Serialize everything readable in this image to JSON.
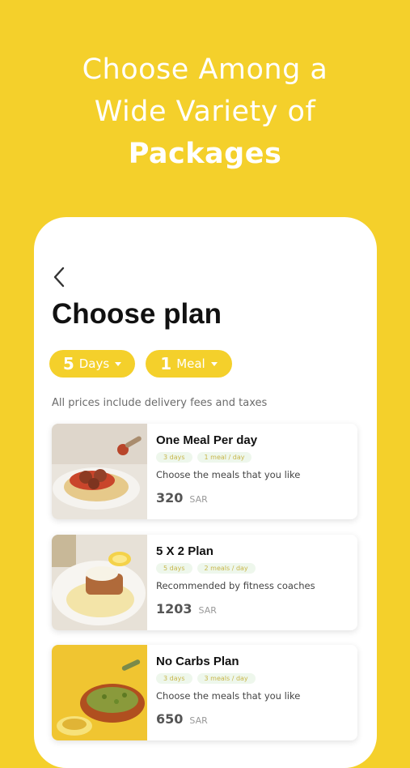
{
  "headline": {
    "line1": "Choose Among a",
    "line2": "Wide Variety of",
    "line3": "Packages"
  },
  "screen": {
    "title": "Choose plan",
    "filters": {
      "days": {
        "number": "5",
        "label": "Days"
      },
      "meals": {
        "number": "1",
        "label": "Meal"
      }
    },
    "note": "All prices include delivery fees and taxes",
    "plans": [
      {
        "name": "One Meal Per day",
        "tags": [
          "3 days",
          "1 meal / day"
        ],
        "description": "Choose the meals that you like",
        "price": "320",
        "currency": "SAR"
      },
      {
        "name": "5 X 2 Plan",
        "tags": [
          "5 days",
          "2 meals / day"
        ],
        "description": "Recommended by fitness coaches",
        "price": "1203",
        "currency": "SAR"
      },
      {
        "name": "No Carbs Plan",
        "tags": [
          "3 days",
          "3 meals / day"
        ],
        "description": "Choose the meals that you like",
        "price": "650",
        "currency": "SAR"
      }
    ]
  },
  "colors": {
    "brand": "#F4D02B",
    "tag_bg": "#eef7ec"
  }
}
